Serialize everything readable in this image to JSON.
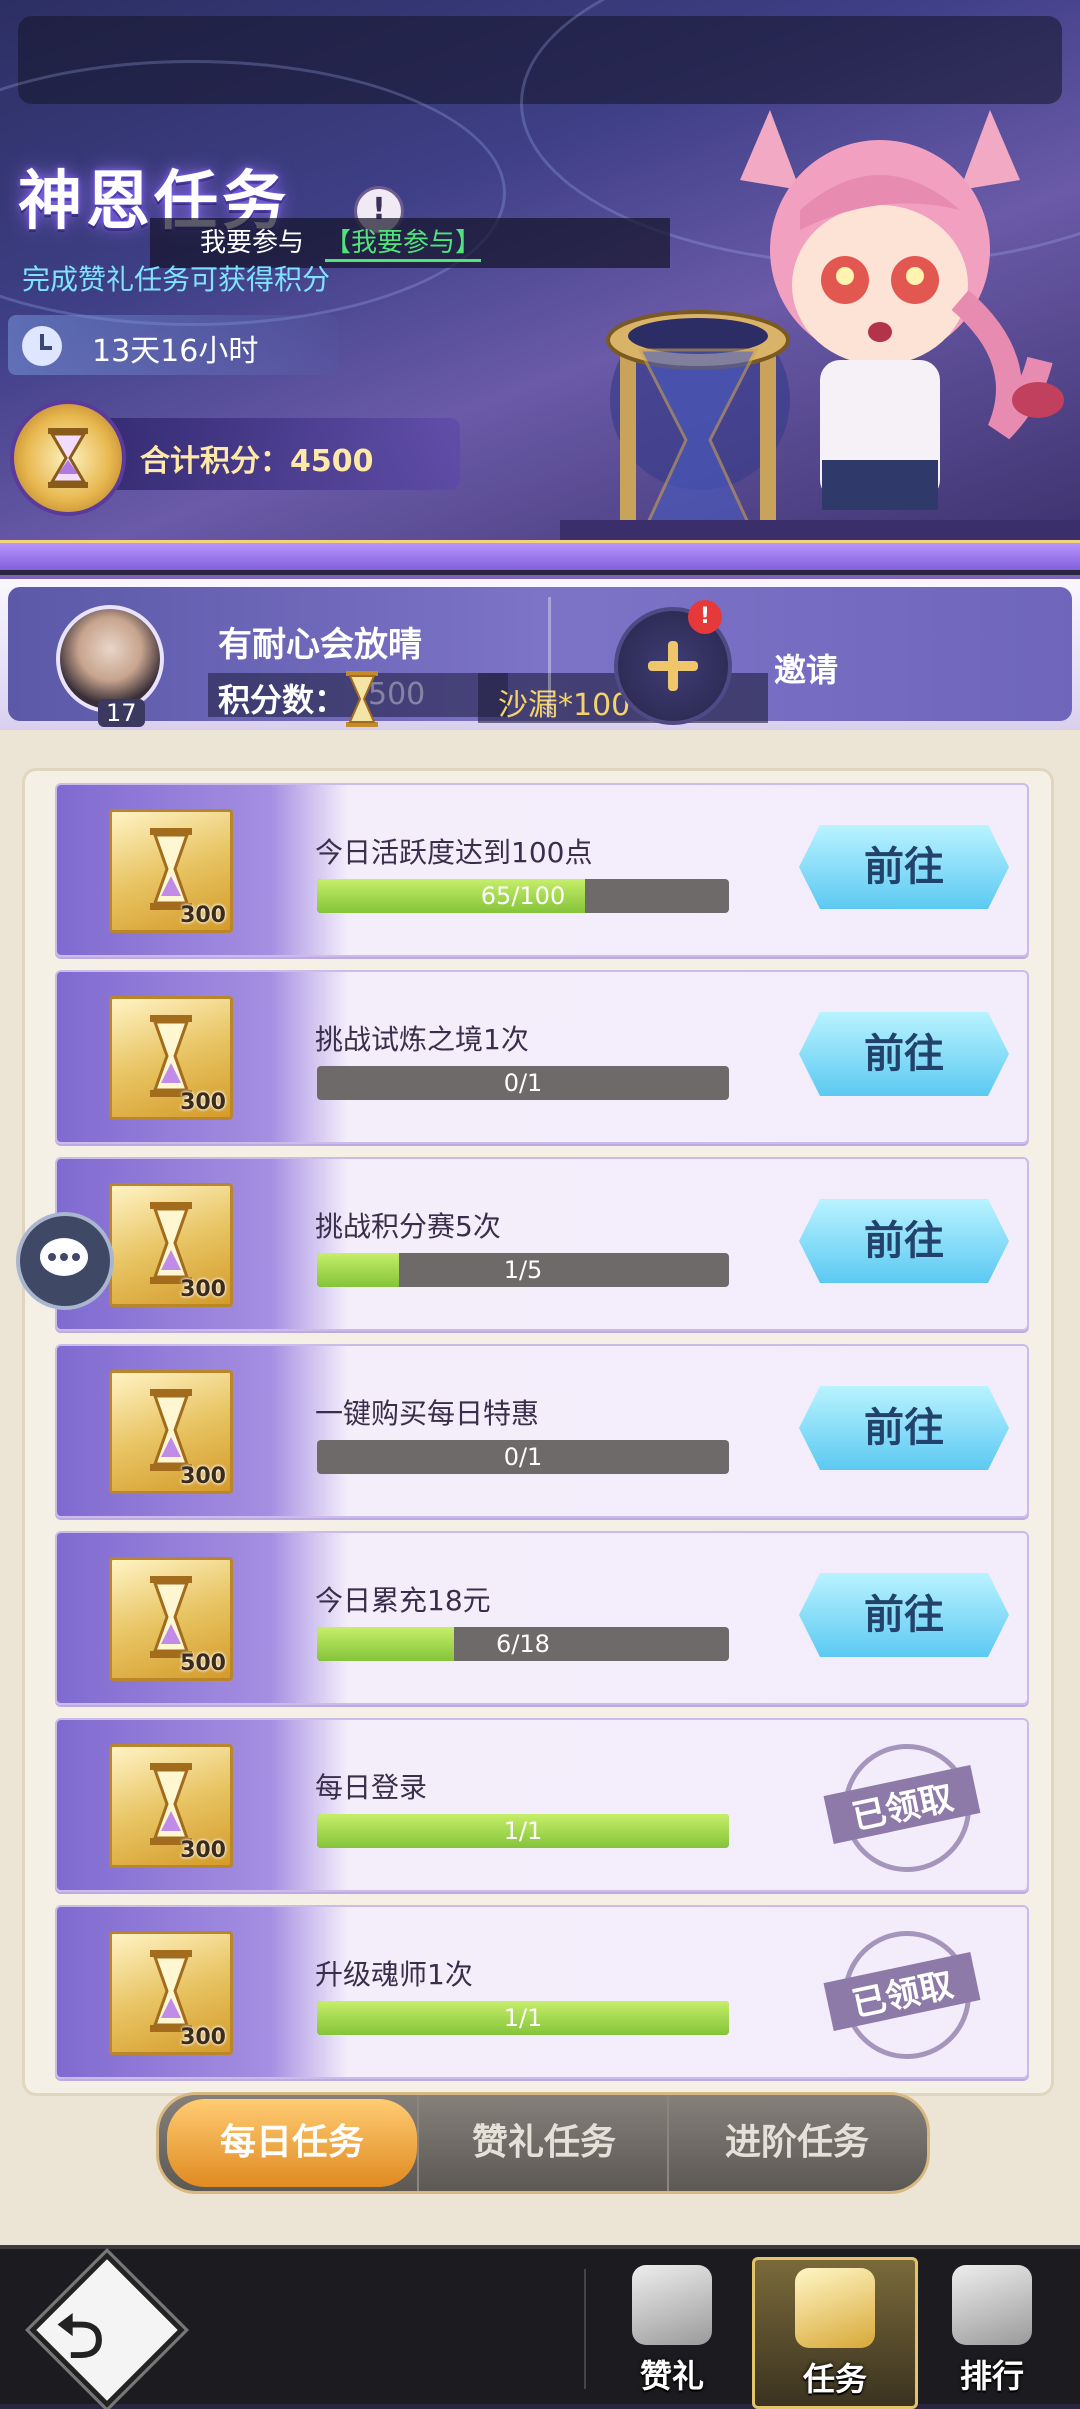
{
  "header": {
    "title": "神恩任务",
    "join_text": "我要参与",
    "join_link": "【我要参与】",
    "subtitle": "完成赞礼任务可获得积分",
    "timer": "13天16小时",
    "total_points": "合计积分：4500"
  },
  "player": {
    "name": "有耐心会放晴",
    "level": "17",
    "score_label": "积分数：",
    "score_value_faded": "500",
    "reward": "沙漏*100",
    "invite_label": "邀请",
    "invite_badge": "!"
  },
  "tasks": [
    {
      "name": "今日活跃度达到100点",
      "reward_count": "300",
      "progress_text": "65/100",
      "progress": 0.65,
      "action": "前往",
      "status": "go"
    },
    {
      "name": "挑战试炼之境1次",
      "reward_count": "300",
      "progress_text": "0/1",
      "progress": 0,
      "action": "前往",
      "status": "go"
    },
    {
      "name": "挑战积分赛5次",
      "reward_count": "300",
      "progress_text": "1/5",
      "progress": 0.2,
      "action": "前往",
      "status": "go"
    },
    {
      "name": "一键购买每日特惠",
      "reward_count": "300",
      "progress_text": "0/1",
      "progress": 0,
      "action": "前往",
      "status": "go"
    },
    {
      "name": "今日累充18元",
      "reward_count": "500",
      "progress_text": "6/18",
      "progress": 0.333,
      "action": "前往",
      "status": "go"
    },
    {
      "name": "每日登录",
      "reward_count": "300",
      "progress_text": "1/1",
      "progress": 1,
      "action": "已领取",
      "status": "claimed"
    },
    {
      "name": "升级魂师1次",
      "reward_count": "300",
      "progress_text": "1/1",
      "progress": 1,
      "action": "已领取",
      "status": "claimed"
    }
  ],
  "tabs": [
    {
      "label": "每日任务",
      "active": true
    },
    {
      "label": "赞礼任务",
      "active": false
    },
    {
      "label": "进阶任务",
      "active": false
    }
  ],
  "bottom_nav": [
    {
      "label": "赞礼",
      "icon": "cup-icon"
    },
    {
      "label": "任务",
      "icon": "scroll-icon",
      "active": true
    },
    {
      "label": "排行",
      "icon": "trophy-icon"
    }
  ],
  "icons": {
    "info": "!",
    "back": "back-arrow-icon",
    "chat": "chat-bubble-icon"
  },
  "colors": {
    "go_button": "#5cc9f2",
    "progress_fill": "#84c43a",
    "active_tab": "#e08a22",
    "link_green": "#52e27a"
  }
}
